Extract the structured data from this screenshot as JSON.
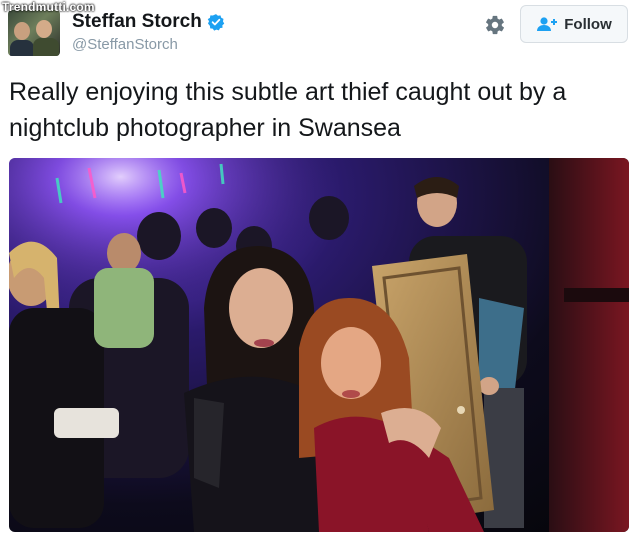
{
  "watermark": "Trendmutti.com",
  "user": {
    "display_name": "Steffan Storch",
    "handle": "@SteffanStorch",
    "verified_icon": "verified-badge-icon"
  },
  "actions": {
    "follow_label": "Follow",
    "follow_icon": "add-user-icon",
    "settings_icon": "gear-icon"
  },
  "tweet": {
    "text": "Really enjoying this subtle art thief caught out by a nightclub photographer in Swansea"
  },
  "colors": {
    "verified_blue": "#1da1f2",
    "name_text": "#14171a",
    "handle_gray": "#8899a6"
  }
}
